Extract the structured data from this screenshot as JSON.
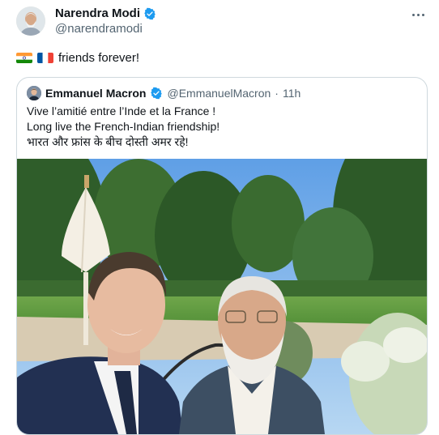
{
  "author": {
    "name": "Narendra Modi",
    "handle": "@narendramodi"
  },
  "tweet": {
    "text": "friends forever!",
    "flags": [
      "india-flag-icon",
      "france-flag-icon"
    ]
  },
  "quoted": {
    "name": "Emmanuel Macron",
    "handle": "@EmmanuelMacron",
    "separator": "·",
    "time": "11h",
    "lines": [
      "Vive l’amitié entre l’Inde et la France !",
      "Long live the French-Indian friendship!",
      "भारत और फ्रांस के बीच दोस्ती अमर रहे!"
    ]
  },
  "colors": {
    "verified": "#1d9bf0",
    "secondary_text": "#536471",
    "border": "#cfd9de"
  }
}
